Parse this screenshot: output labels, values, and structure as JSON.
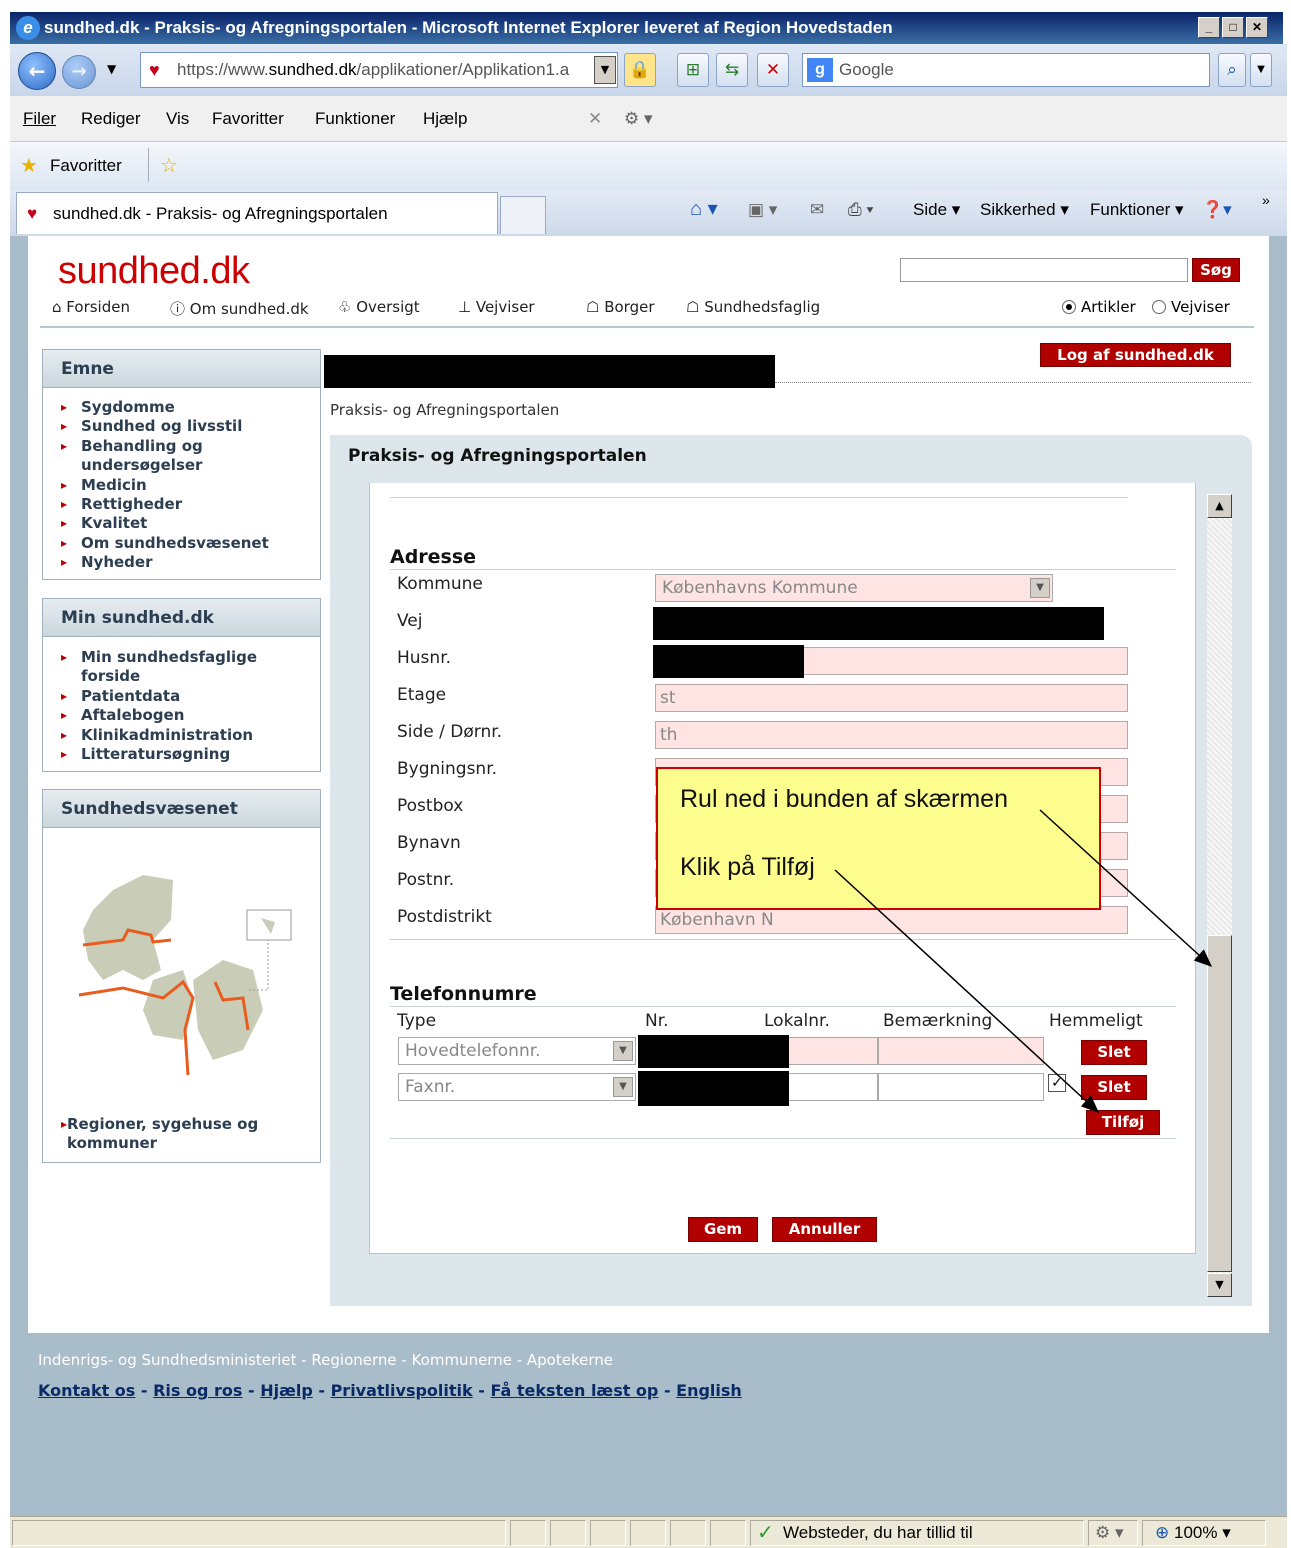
{
  "window": {
    "title": "sundhed.dk - Praksis- og Afregningsportalen - Microsoft Internet Explorer leveret af Region Hovedstaden"
  },
  "browser": {
    "url_prefix": "https://www.",
    "url_domain": "sundhed.dk",
    "url_path": "/applikationer/Applikation1.a",
    "search_placeholder": "Google",
    "menu": [
      "Filer",
      "Rediger",
      "Vis",
      "Favoritter",
      "Funktioner",
      "Hjælp"
    ],
    "favorites_label": "Favoritter",
    "tab_title": "sundhed.dk - Praksis- og Afregningsportalen",
    "commands": [
      "Side",
      "Sikkerhed",
      "Funktioner"
    ]
  },
  "site": {
    "logo": "sundhed.dk",
    "nav": [
      "Forsiden",
      "Om sundhed.dk",
      "Oversigt",
      "Vejviser",
      "Borger",
      "Sundhedsfaglig"
    ],
    "search_button": "Søg",
    "radio": [
      "Artikler",
      "Vejviser"
    ],
    "logout": "Log af sundhed.dk"
  },
  "sidebar": {
    "emne_title": "Emne",
    "emne_items": [
      "Sygdomme",
      "Sundhed og livsstil",
      "Behandling og undersøgelser",
      "Medicin",
      "Rettigheder",
      "Kvalitet",
      "Om sundhedsvæsenet",
      "Nyheder"
    ],
    "min_title": "Min sundhed.dk",
    "min_items": [
      "Min sundhedsfaglige forside",
      "Patientdata",
      "Aftalebogen",
      "Klinikadministration",
      "Litteratursøgning"
    ],
    "sv_title": "Sundhedsvæsenet",
    "sv_link": "Regioner, sygehuse og kommuner"
  },
  "content": {
    "breadcrumb": "Praksis- og Afregningsportalen",
    "panel_title": "Praksis- og Afregningsportalen",
    "address_title": "Adresse",
    "labels": [
      "Kommune",
      "Vej",
      "Husnr.",
      "Etage",
      "Side / Dørnr.",
      "Bygningsnr.",
      "Postbox",
      "Bynavn",
      "Postnr.",
      "Postdistrikt"
    ],
    "kommune": "Københavns Kommune",
    "etage": "st",
    "side": "th",
    "postdistrikt": "København N",
    "phone_title": "Telefonnumre",
    "phone_headers": [
      "Type",
      "Nr.",
      "Lokalnr.",
      "Bemærkning",
      "Hemmeligt"
    ],
    "phone_types": [
      "Hovedtelefonnr.",
      "Faxnr."
    ],
    "delete_label": "Slet",
    "add_label": "Tilføj",
    "save_label": "Gem",
    "cancel_label": "Annuller"
  },
  "callout": {
    "line1": "Rul ned i bunden af skærmen",
    "line2": "Klik på Tilføj"
  },
  "footer": {
    "orgs": "Indenrigs- og Sundhedsministeriet - Regionerne - Kommunerne - Apotekerne",
    "links": [
      "Kontakt os",
      "Ris og ros",
      "Hjælp",
      "Privatlivspolitik",
      "Få teksten læst op",
      "English"
    ]
  },
  "statusbar": {
    "zone": "Websteder, du har tillid til",
    "zoom": "100%"
  }
}
